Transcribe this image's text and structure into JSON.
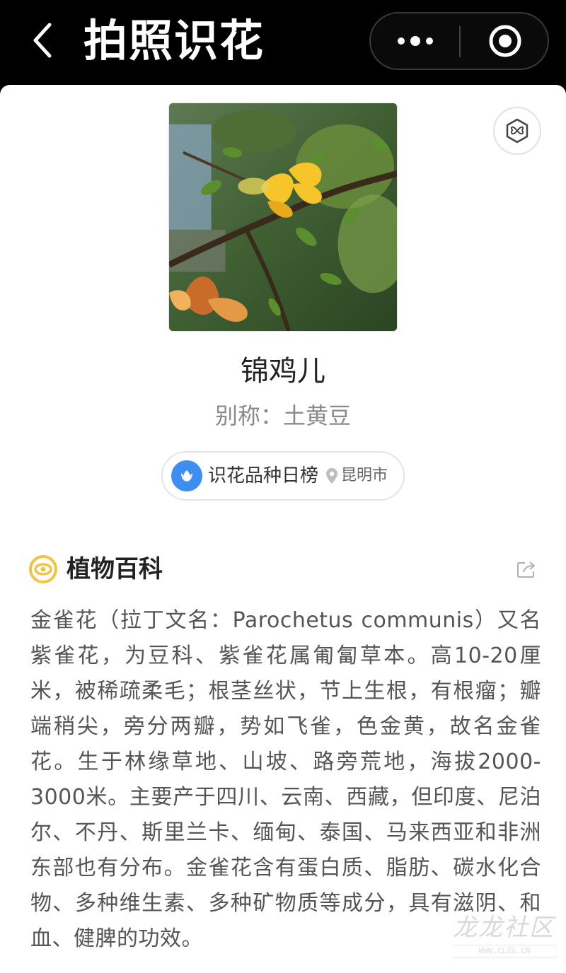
{
  "navbar": {
    "title": "拍照识花",
    "back_icon": "chevron-left-icon",
    "more_icon": "more-dots-icon",
    "close_icon": "target-circle-icon"
  },
  "plant": {
    "name": "锦鸡儿",
    "alias": "别称：土黄豆",
    "tag_icon": "flower-tag-icon"
  },
  "ranking": {
    "label": "识花品种日榜",
    "city": "昆明市",
    "logo_icon": "tulip-logo-icon",
    "pin_icon": "location-pin-icon"
  },
  "encyclopedia": {
    "title": "植物百科",
    "icon": "eye-circle-icon",
    "share_icon": "share-icon",
    "text": "金雀花（拉丁文名：Parochetus communis）又名紫雀花，为豆科、紫雀花属匍匐草本。高10-20厘米，被稀疏柔毛；根茎丝状，节上生根，有根瘤；瓣端稍尖，旁分两瓣，势如飞雀，色金黄，故名金雀花。生于林缘草地、山坡、路旁荒地，海拔2000-3000米。主要产于四川、云南、西藏，但印度、尼泊尔、不丹、斯里兰卡、缅甸、泰国、马来西亚和非洲东部也有分布。金雀花含有蛋白质、脂肪、碳水化合物、多种维生素、多种矿物质等成分，具有滋阴、和血、健脾的功效。"
  },
  "watermark": {
    "title": "龙龙社区",
    "url": "WWW.CLZG.CN"
  },
  "colors": {
    "accent_blue": "#3d8ef0",
    "accent_yellow": "#f5c242",
    "navbar_bg": "#000000"
  }
}
